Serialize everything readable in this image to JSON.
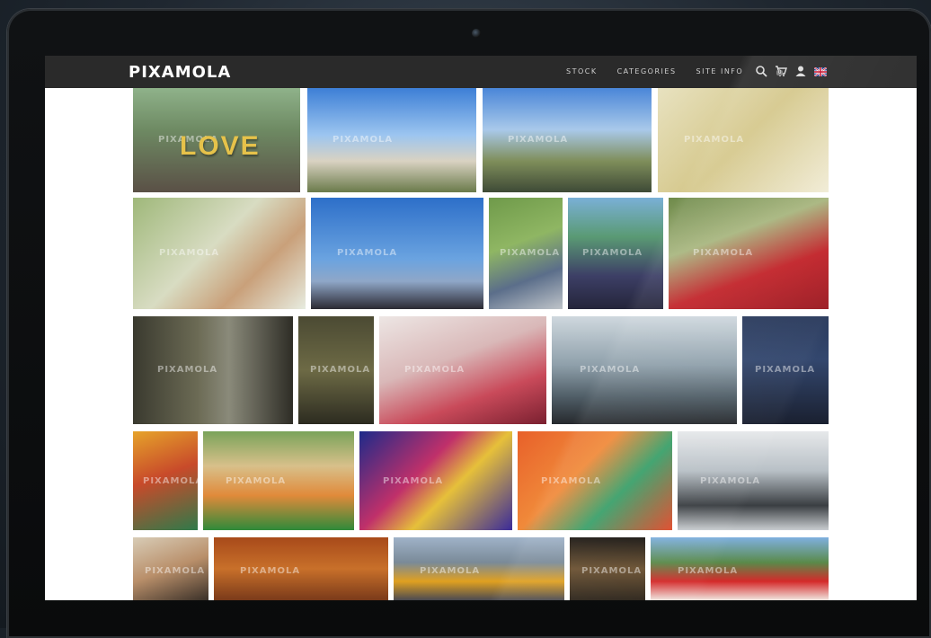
{
  "app": {
    "logo": "PIXAMOLA"
  },
  "nav": {
    "items": [
      {
        "label": "STOCK"
      },
      {
        "label": "CATEGORIES"
      },
      {
        "label": "SITE INFO"
      }
    ],
    "cart_count": "0"
  },
  "watermark": "PIXAMOLA",
  "tiles": [
    {
      "label": "LOVE",
      "subject": "couple-with-love-balloons"
    },
    {
      "subject": "couple-relaxing-on-field"
    },
    {
      "subject": "couple-on-motorbike"
    },
    {
      "subject": "woman-in-golden-field"
    },
    {
      "subject": "woman-red-hair-in-grass"
    },
    {
      "subject": "couple-on-mountain"
    },
    {
      "subject": "old-man-with-plants"
    },
    {
      "subject": "market-umbrella"
    },
    {
      "subject": "girls-in-hijab"
    },
    {
      "subject": "woman-in-forest"
    },
    {
      "subject": "hand-in-darkness"
    },
    {
      "subject": "hijab-woman-with-flowers"
    },
    {
      "subject": "legs-against-mountains"
    },
    {
      "subject": "woman-portrait-dark"
    },
    {
      "subject": "carnival-dancer"
    },
    {
      "subject": "carnival-parade"
    },
    {
      "subject": "carnival-queen-blue"
    },
    {
      "subject": "carnival-queen-orange"
    },
    {
      "subject": "woman-squatting-street"
    },
    {
      "subject": "woman-portrait-bright"
    },
    {
      "subject": "woman-face-paint"
    },
    {
      "subject": "woman-red-hair-city"
    },
    {
      "subject": "woman-night-lights"
    },
    {
      "subject": "marching-band"
    }
  ],
  "icons": {
    "search": "search-icon",
    "cart": "cart-icon",
    "user": "user-icon",
    "language": "uk-flag-icon"
  }
}
